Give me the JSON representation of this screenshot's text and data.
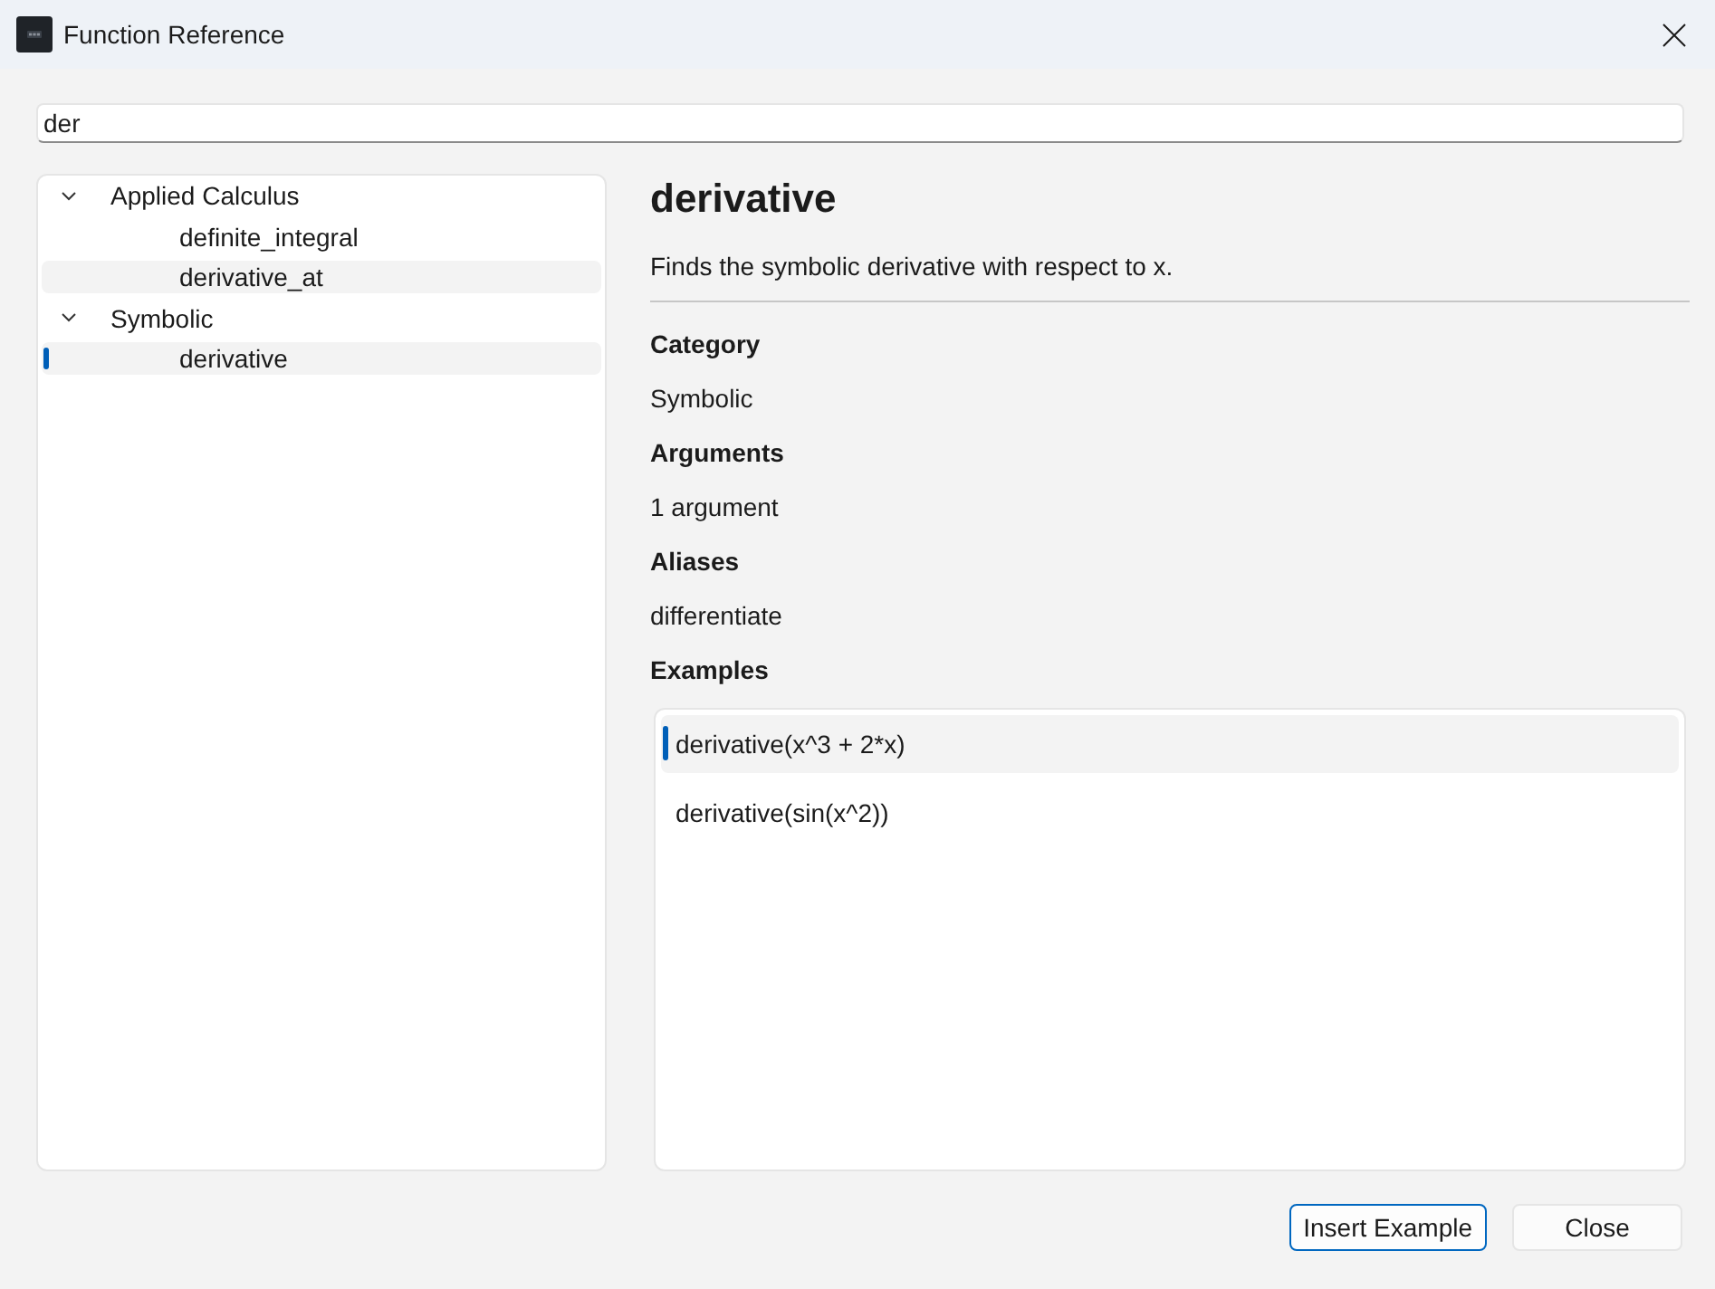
{
  "window": {
    "title": "Function Reference"
  },
  "search": {
    "value": "der"
  },
  "tree": [
    {
      "label": "Applied Calculus",
      "expanded": true,
      "selected": false,
      "hovered": false,
      "children": [
        {
          "label": "definite_integral",
          "selected": false,
          "hovered": false
        },
        {
          "label": "derivative_at",
          "selected": false,
          "hovered": true
        }
      ]
    },
    {
      "label": "Symbolic",
      "expanded": true,
      "selected": false,
      "hovered": false,
      "children": [
        {
          "label": "derivative",
          "selected": true,
          "hovered": false
        }
      ]
    }
  ],
  "detail": {
    "title": "derivative",
    "description": "Finds the symbolic derivative with respect to x.",
    "fields": [
      {
        "heading": "Category",
        "value": "Symbolic"
      },
      {
        "heading": "Arguments",
        "value": "1 argument"
      },
      {
        "heading": "Aliases",
        "value": "differentiate"
      }
    ],
    "examples": {
      "heading": "Examples",
      "items": [
        {
          "text": "derivative(x^3 + 2*x)",
          "selected": true
        },
        {
          "text": "derivative(sin(x^2))",
          "selected": false
        }
      ]
    }
  },
  "buttons": [
    {
      "label": "Insert Example",
      "default": true
    },
    {
      "label": "Close",
      "default": false
    }
  ]
}
